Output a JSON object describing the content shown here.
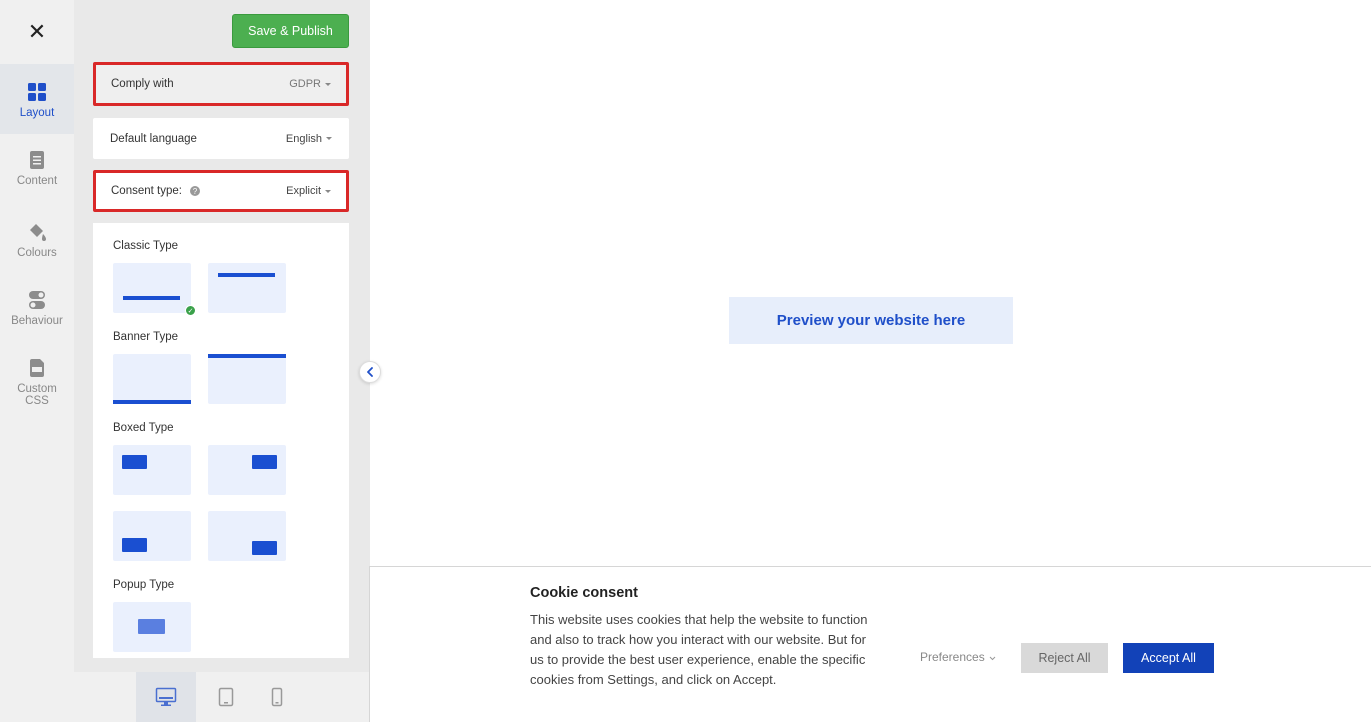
{
  "rail": {
    "close_glyph": "✕",
    "items": [
      {
        "label": "Layout",
        "icon": "layout-grid-icon"
      },
      {
        "label": "Content",
        "icon": "document-icon"
      },
      {
        "label": "Colours",
        "icon": "paint-bucket-icon"
      },
      {
        "label": "Behaviour",
        "icon": "toggle-icon"
      },
      {
        "label": "Custom CSS",
        "icon": "css-file-icon"
      }
    ]
  },
  "panel": {
    "save_label": "Save & Publish",
    "comply": {
      "label": "Comply with",
      "value": "GDPR"
    },
    "language": {
      "label": "Default language",
      "value": "English"
    },
    "consent": {
      "label": "Consent type:",
      "value": "Explicit"
    },
    "sections": {
      "classic": "Classic Type",
      "banner": "Banner Type",
      "boxed": "Boxed Type",
      "popup": "Popup Type"
    }
  },
  "preview": {
    "label": "Preview your website here"
  },
  "cookie": {
    "title": "Cookie consent",
    "text": "This website uses cookies that help the website to function and also to track how you interact with our website. But for us to provide the best user experience, enable the specific cookies from Settings, and click on Accept.",
    "preferences": "Preferences",
    "reject": "Reject All",
    "accept": "Accept All"
  },
  "colors": {
    "accent": "#1f4fc9",
    "save": "#4caf50",
    "highlight": "#d92828",
    "accept": "#1242b8"
  }
}
